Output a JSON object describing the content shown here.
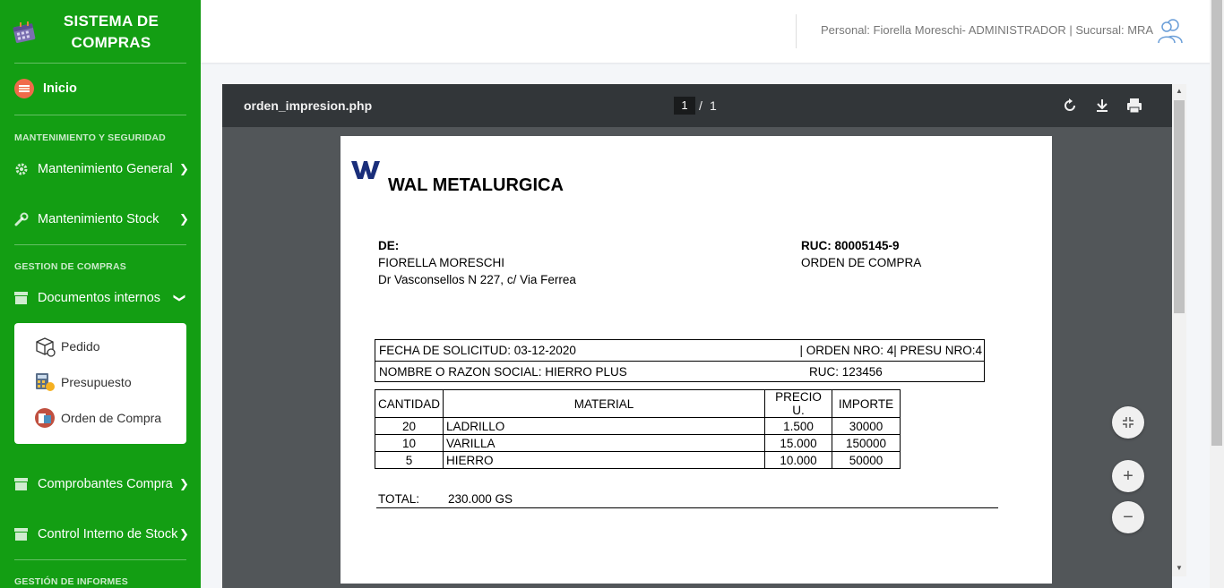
{
  "sidebar": {
    "brand_line1": "SISTEMA DE",
    "brand_line2": "COMPRAS",
    "home": "Inicio",
    "section1": "MANTENIMIENTO Y SEGURIDAD",
    "mant_general": "Mantenimiento General",
    "mant_stock": "Mantenimiento Stock",
    "section2": "GESTION DE COMPRAS",
    "docs_internos": "Documentos internos",
    "sub_items": [
      "Pedido",
      "Presupuesto",
      "Orden de Compra"
    ],
    "comprobantes": "Comprobantes Compra",
    "control_stock": "Control Interno de Stock",
    "section3": "GESTIÓN DE INFORMES",
    "colors": {
      "bg": "#139e13"
    }
  },
  "topbar": {
    "user_info": "Personal: Fiorella Moreschi- ADMINISTRADOR | Sucursal: MRA",
    "user_icon": "user-avatar-icon"
  },
  "viewer": {
    "filename": "orden_impresion.php",
    "current_page": "1",
    "page_sep": "/",
    "total_pages": "1",
    "icons": [
      "rotate-icon",
      "download-icon",
      "print-icon"
    ]
  },
  "document": {
    "company": "WAL METALURGICA",
    "de_label": "DE:",
    "de_name": "FIORELLA MORESCHI",
    "de_address": "Dr Vasconsellos N 227, c/ Via Ferrea",
    "ruc": "RUC: 80005145-9",
    "doc_type": "ORDEN DE COMPRA",
    "fecha": "FECHA DE SOLICITUD: 03-12-2020",
    "orden_presu": "| ORDEN NRO: 4| PRESU NRO:4",
    "razon_social": "NOMBRE O RAZON SOCIAL: HIERRO PLUS",
    "ruc_proveedor": "RUC: 123456",
    "columns": [
      "CANTIDAD",
      "MATERIAL",
      "PRECIO U.",
      "IMPORTE"
    ],
    "rows": [
      [
        "20",
        "LADRILLO",
        "1.500",
        "30000"
      ],
      [
        "10",
        "VARILLA",
        "15.000",
        "150000"
      ],
      [
        "5",
        "HIERRO",
        "10.000",
        "50000"
      ]
    ],
    "total_label": "TOTAL:",
    "total_value": "230.000 GS"
  },
  "controls": {
    "fit": "fit-page-icon",
    "zoom_in": "+",
    "zoom_out": "−"
  }
}
